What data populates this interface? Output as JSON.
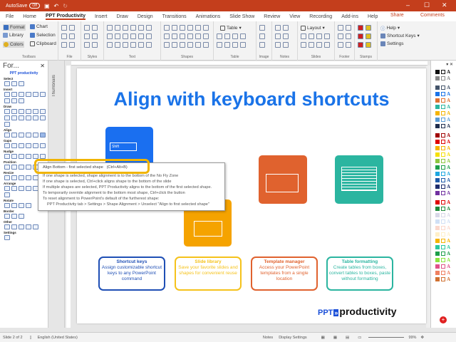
{
  "titlebar": {
    "autosave": "AutoSave",
    "toggle": "Off"
  },
  "tabs": [
    "File",
    "Home",
    "PPT Productivity",
    "Insert",
    "Draw",
    "Design",
    "Transitions",
    "Animations",
    "Slide Show",
    "Review",
    "View",
    "Recording",
    "Add-ins",
    "Help"
  ],
  "share": "Share",
  "comments": "Comments",
  "ribbon": {
    "toolbars": {
      "format": "Format",
      "library": "Library",
      "colors": "Colors",
      "chart": "Chart",
      "selection": "Selection",
      "clipboard": "Clipboard",
      "label": "Toolbars"
    },
    "groups": [
      "File",
      "Styles",
      "Text",
      "Shapes",
      "Table",
      "Image",
      "Notes",
      "Slides",
      "Footer",
      "Stamps"
    ],
    "table_btn": "Table",
    "layout_btn": "Layout",
    "help": "Help",
    "shortcut_keys": "Shortcut Keys",
    "settings": "Settings"
  },
  "leftpane": {
    "title": "For...",
    "logo": "PPT productivity",
    "sections": [
      {
        "name": "Select",
        "n": 3
      },
      {
        "name": "Insert",
        "n": 9
      },
      {
        "name": "Draw",
        "n": 13
      },
      {
        "name": "Align",
        "n": 6
      },
      {
        "name": "Gaps",
        "n": 6
      },
      {
        "name": "Nudge",
        "n": 6
      },
      {
        "name": "Position",
        "n": 5
      },
      {
        "name": "Resize",
        "n": 6
      },
      {
        "name": "Arrange",
        "n": 7
      },
      {
        "name": "Rotate",
        "n": 4
      },
      {
        "name": "Border",
        "n": 3
      },
      {
        "name": "Other",
        "n": 5
      },
      {
        "name": "Settings",
        "n": 1
      }
    ]
  },
  "thumbnails": "Thumbnails",
  "slide": {
    "title": "Align with keyboard shortcuts",
    "key_shift": "Shift",
    "features": [
      {
        "title": "Shortcut keys",
        "body": "Assign customizable shortcut keys to any PowerPoint command",
        "color": "#1f4fb5"
      },
      {
        "title": "Slide library",
        "body": "Save your favorite slides and shapes for convenient reuse",
        "color": "#f5c21b"
      },
      {
        "title": "Template manager",
        "body": "Access your PowerPoint templates from a single location",
        "color": "#e0622e"
      },
      {
        "title": "Table formatting",
        "body": "Create tables from boxes, convert tables to boxes, paste without formatting",
        "color": "#2bb5a0"
      }
    ],
    "logo_ppt": "PPT",
    "logo_word": "productivity"
  },
  "tooltip": {
    "title": "Align Bottom - first selected shape",
    "shortcut": "(Ctrl+Alt+B)",
    "lines": [
      "If one shape is selected, shape alignment is to the bottom of the No Fly Zone",
      "If one shape is selected, Ctrl+click aligns shape to the bottom of the slide",
      "If multiple shapes are selected, PPT Productivity aligns to the bottom of the first selected shape.",
      "To temporarily override alignment to the bottom most shape, Ctrl+click the button",
      "To reset alignment to PowerPoint's default of the furtherest shape:",
      "PPT Productivity tab > Settings > Shape Alignment > Unselect \"Align to first selected shape\""
    ]
  },
  "swatches": [
    "#111111",
    "#888888",
    "#44546a",
    "#1a73e8",
    "#e07030",
    "#2bb5a0",
    "#f5b400",
    "#5b9bd5",
    "#1f2d4d",
    "#a00000",
    "#e00000",
    "#f5b400",
    "#f5e000",
    "#8cc63f",
    "#1e9e4a",
    "#1ea7e0",
    "#1f5aa8",
    "#1f2d6d",
    "#7030a0",
    "#e00000",
    "#1e8a3a",
    "#d8d8e8",
    "#d0e0f5",
    "#fbd8cc",
    "#fff0c8",
    "#f5b400",
    "#2bc8a0",
    "#1e9e4a",
    "#8ce63f",
    "#e0508a",
    "#f08060",
    "#d07030"
  ],
  "status": {
    "slide": "Slide 2 of 2",
    "language": "English (United States)",
    "notes": "Notes",
    "display": "Display Settings",
    "zoom": "99%"
  }
}
